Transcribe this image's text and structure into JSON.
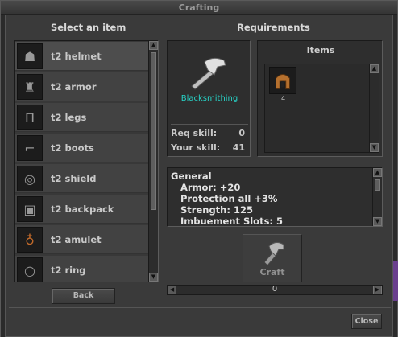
{
  "window": {
    "title": "Crafting"
  },
  "headers": {
    "select_item": "Select an item",
    "requirements": "Requirements"
  },
  "item_list": [
    {
      "label": "t2 helmet",
      "icon": "helmet-icon",
      "selected": true
    },
    {
      "label": "t2 armor",
      "icon": "armor-icon",
      "selected": false
    },
    {
      "label": "t2 legs",
      "icon": "legs-icon",
      "selected": false
    },
    {
      "label": "t2 boots",
      "icon": "boots-icon",
      "selected": false
    },
    {
      "label": "t2 shield",
      "icon": "shield-icon",
      "selected": false
    },
    {
      "label": "t2 backpack",
      "icon": "backpack-icon",
      "selected": false
    },
    {
      "label": "t2 amulet",
      "icon": "amulet-icon",
      "selected": false
    },
    {
      "label": "t2 ring",
      "icon": "ring-icon",
      "selected": false
    }
  ],
  "profession": {
    "name": "Blacksmithing",
    "icon": "hammer-icon"
  },
  "skills": {
    "req_label": "Req skill:",
    "req_value": "0",
    "your_label": "Your skill:",
    "your_value": "41"
  },
  "items_panel": {
    "title": "Items",
    "materials": [
      {
        "icon": "helmet-icon",
        "count": "4"
      }
    ]
  },
  "description": {
    "lines": [
      "General",
      "Armor: +20",
      "Protection all +3%",
      "Strength: 125",
      "Imbuement Slots: 5"
    ]
  },
  "craft_button": {
    "label": "Craft",
    "icon": "craft-hammer-icon"
  },
  "amount": {
    "value": "0"
  },
  "buttons": {
    "back": "Back",
    "close": "Close"
  },
  "colors": {
    "accent_profession": "#27d4c8"
  }
}
